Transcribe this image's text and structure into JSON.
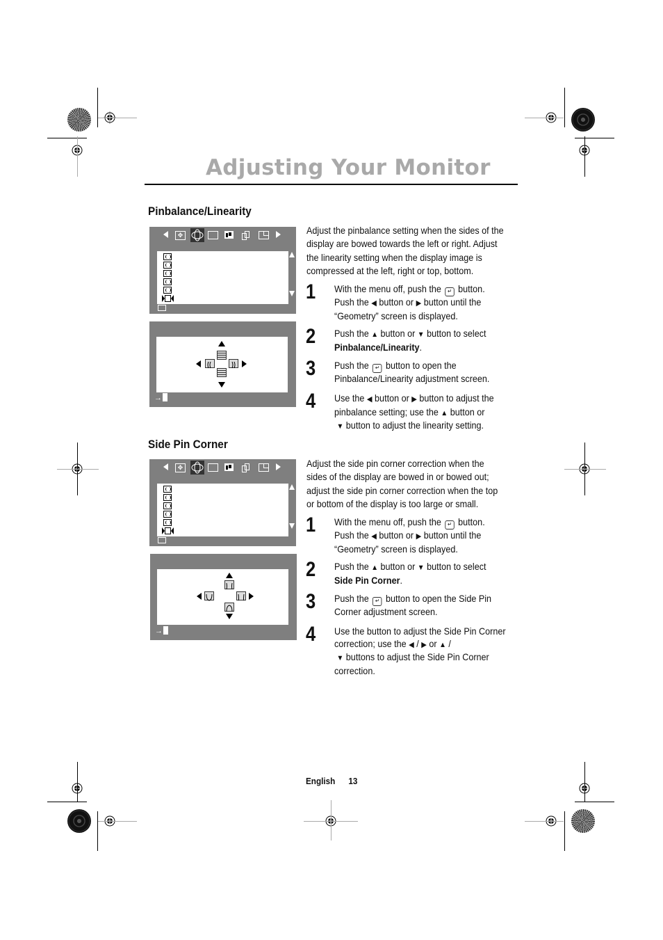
{
  "page": {
    "title": "Adjusting Your Monitor",
    "footer_language": "English",
    "footer_page": "13"
  },
  "sections": [
    {
      "title": "Pinbalance/Linearity",
      "intro": [
        "Adjust the pinbalance setting when the sides of the",
        "display are bowed towards the left or right. Adjust",
        "the linearity setting when the display image is",
        "compressed at the left, right or top, bottom."
      ],
      "steps": [
        {
          "num": "1",
          "lines": [
            "With the menu off, push the [enter] button.",
            "Push the ◀ button or ▶ button until the",
            "“Geometry” screen is displayed."
          ]
        },
        {
          "num": "2",
          "lines": [
            "Push the ▲ button or ▼ button to select",
            "Pinbalance/Linearity."
          ]
        },
        {
          "num": "3",
          "lines": [
            "Push the [enter] button to open the",
            "Pinbalance/Linearity adjustment screen."
          ]
        },
        {
          "num": "4",
          "lines": [
            "Use the ◀ button or ▶ button to adjust the",
            "pinbalance setting; use the ▲ button or",
            " ▼ button to adjust the linearity setting."
          ]
        }
      ],
      "step_parts": {
        "s1a": "With the menu off, push the",
        "s1b": "button.",
        "s1c": "Push the",
        "s1d": "button or",
        "s1e": "button until the",
        "s1f": "“Geometry” screen is displayed.",
        "s2a": "Push the",
        "s2b": "button or",
        "s2c": "button to select",
        "s2bold": "Pinbalance/Linearity",
        "s3a": "Push the",
        "s3b": "button to open the",
        "s3c": "Pinbalance/Linearity adjustment screen.",
        "s4a": "Use the",
        "s4b": "button or",
        "s4c": "button to adjust the",
        "s4d": "pinbalance setting; use the",
        "s4e": "button or",
        "s4f": "button to adjust the linearity setting."
      }
    },
    {
      "title": "Side Pin Corner",
      "intro": [
        "Adjust the side pin corner correction when the",
        "sides of the display are bowed in or bowed out;",
        "adjust the side pin corner correction when the top",
        "or bottom of the display is too large or small."
      ],
      "step_parts": {
        "s1a": "With the menu off, push the",
        "s1b": "button.",
        "s1c": "Push the",
        "s1d": "button or",
        "s1e": "button until the",
        "s1f": "“Geometry” screen is displayed.",
        "s2a": "Push the",
        "s2b": "button or",
        "s2c": "button to select",
        "s2bold": "Side Pin Corner",
        "s3a": "Push the",
        "s3b": "button to open the Side Pin",
        "s3c": "Corner adjustment screen.",
        "s4a": "Use the button to adjust the Side Pin Corner",
        "s4b": "correction; use the",
        "s4c": "/",
        "s4d": "or",
        "s4e": "/",
        "s4f": "buttons to adjust the Side Pin Corner",
        "s4g": "correction."
      }
    }
  ],
  "step_numbers": [
    "1",
    "2",
    "3",
    "4"
  ],
  "symbols": {
    "left": "◀",
    "right": "▶",
    "up": "▲",
    "down": "▼",
    "enter": "↵",
    "period": "."
  },
  "osd": {
    "menu_icons": [
      "left-arrow",
      "position-icon",
      "geometry-icon",
      "size-icon",
      "color-icon",
      "image-icon",
      "setup-icon",
      "right-arrow"
    ],
    "selected_menu": "geometry-icon",
    "list_items": [
      "pincushion-icon",
      "trapezoid-icon",
      "pinbalance-icon",
      "parallelogram-icon",
      "rotation-icon",
      "linearity-icon"
    ]
  }
}
